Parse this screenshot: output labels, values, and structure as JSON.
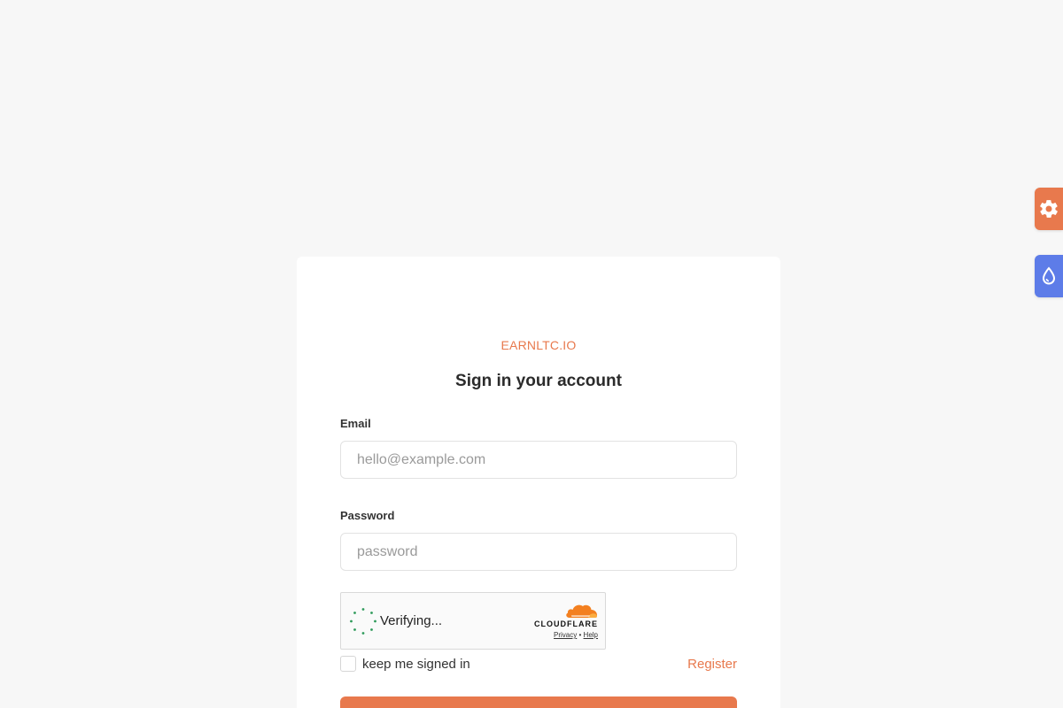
{
  "brand": {
    "name": "EARNLTC.IO"
  },
  "form": {
    "title": "Sign in your account",
    "email": {
      "label": "Email",
      "placeholder": "hello@example.com",
      "value": ""
    },
    "password": {
      "label": "Password",
      "placeholder": "password",
      "value": ""
    },
    "remember": {
      "label": "keep me signed in",
      "checked": false
    },
    "register_link": "Register",
    "submit_label": ""
  },
  "captcha": {
    "status": "Verifying...",
    "provider": "CLOUDFLARE",
    "privacy_link": "Privacy",
    "separator": "•",
    "help_link": "Help"
  },
  "side_buttons": {
    "settings_icon": "gear-icon",
    "theme_icon": "droplet-icon"
  },
  "colors": {
    "accent": "#e8794d",
    "secondary": "#5d7ce8",
    "background": "#f7f7f7",
    "cloudflare_orange": "#f38020",
    "spinner_green": "#2e9a5a"
  }
}
